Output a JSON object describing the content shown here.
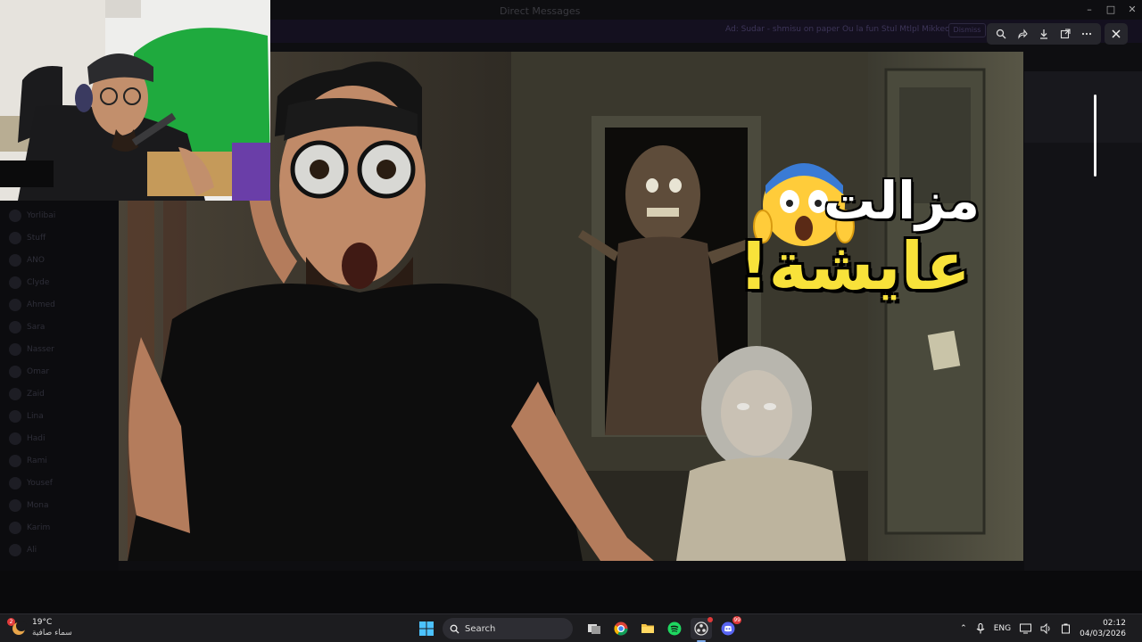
{
  "window": {
    "title": "Direct Messages",
    "banner_text": "Ad:   Sudar - shmisu on paper  Ou   la   fun  Stul Mtlpl Mikkeo",
    "banner_button": "Dismiss"
  },
  "sidebar_rows": [
    "Yorlibai",
    "Stuff",
    "ANO",
    "Clyde",
    "Ahmed",
    "Sara",
    "Nasser",
    "Omar",
    "Zaid",
    "Lina",
    "Hadi",
    "Rami",
    "Yousef",
    "Mona",
    "Karim",
    "Ali"
  ],
  "viewer": {
    "tools": [
      "zoom-icon",
      "forward-icon",
      "download-icon",
      "open-external-icon",
      "more-icon"
    ],
    "close_icon": "close-icon"
  },
  "thumbnail": {
    "title_line1": "مزالت",
    "title_line2": "عايشة!",
    "emoji": "😱"
  },
  "taskbar": {
    "weather_temp": "19°C",
    "weather_desc": "سماء صافية",
    "weather_badge": "2",
    "search_label": "Search",
    "apps": [
      "task-view",
      "chrome",
      "file-explorer",
      "spotify",
      "obs",
      "discord"
    ],
    "discord_badge": "99",
    "language": "ENG",
    "time": "02:12",
    "date": "04/03/2026"
  }
}
